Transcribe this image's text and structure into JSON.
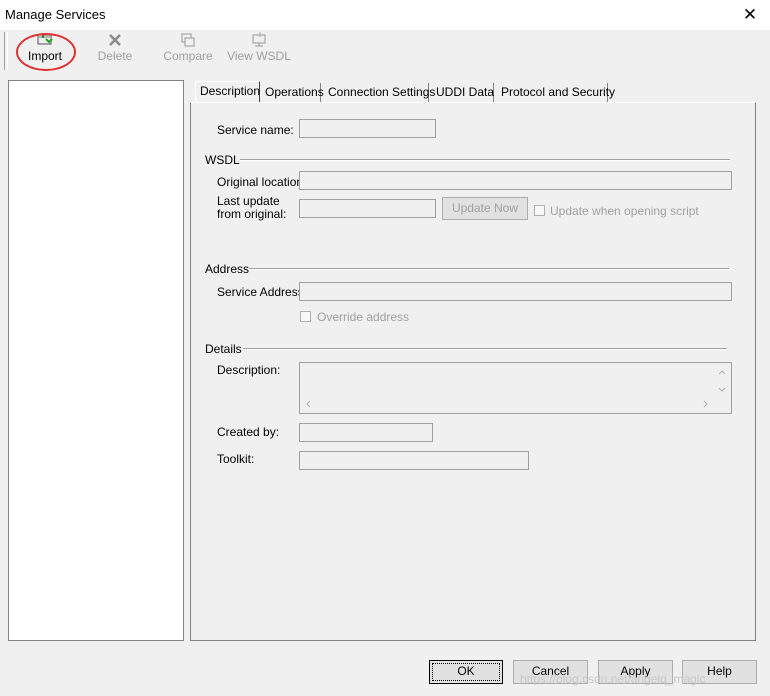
{
  "window": {
    "title": "Manage Services",
    "close_glyph": "✕"
  },
  "toolbar": {
    "import_label": "Import",
    "delete_label": "Delete",
    "compare_label": "Compare",
    "view_wsdl_label": "View WSDL"
  },
  "tabs": [
    {
      "label": "Description"
    },
    {
      "label": "Operations"
    },
    {
      "label": "Connection Settings"
    },
    {
      "label": "UDDI Data"
    },
    {
      "label": "Protocol and Security"
    }
  ],
  "description_tab": {
    "service_name_label": "Service name:",
    "wsdl_section": "WSDL",
    "original_location_label": "Original location:",
    "last_update_label_line1": "Last update",
    "last_update_label_line2": "from original:",
    "update_now_label": "Update Now",
    "update_when_opening_label": "Update when opening script",
    "address_section": "Address",
    "service_address_label": "Service Address:",
    "override_address_label": "Override address",
    "details_section": "Details",
    "description_label": "Description:",
    "created_by_label": "Created by:",
    "toolkit_label": "Toolkit:"
  },
  "footer": {
    "ok_label": "OK",
    "cancel_label": "Cancel",
    "apply_label": "Apply",
    "help_label": "Help"
  },
  "watermark": "https://blog.csdn.net/angelq_magic"
}
